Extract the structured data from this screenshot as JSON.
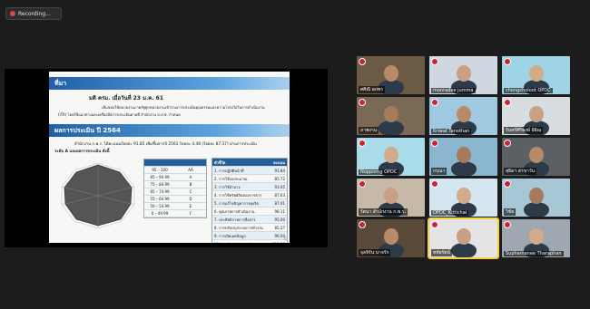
{
  "recording": {
    "label": "Recording..."
  },
  "slide": {
    "section1": "ที่มา",
    "resolution": "มติ ครม. เมื่อวันที่ 23 ม.ค. 61",
    "line1": "เห็นชอบให้หน่วยงานภาครัฐทุกหน่วยงานเข้าร่วมการประเมินคุณธรรมและความโปร่งใสในการดำเนินงาน",
    "line2": "(ITA) โดยใช้แนวทางและเครื่องมือการประเมินตามที่ สำนักงาน ป.ป.ช. กำหนด",
    "section2": "ผลการประเมิน ปี 2564",
    "result1": "สำนักงาน ก.พ.ร. ได้คะแนนร้อยละ 91.85 เพิ่มขึ้นจากปี 2563 ร้อยละ 4.48 (ร้อยละ 87.37) ผ่านการประเมิน",
    "result2": "ระดับ A และผลการประเมิน ดังนี้",
    "grades": [
      {
        "range": "95 – 100",
        "g": "AA"
      },
      {
        "range": "85 – 94.99",
        "g": "A"
      },
      {
        "range": "75 – 84.99",
        "g": "B"
      },
      {
        "range": "65 – 74.99",
        "g": "C"
      },
      {
        "range": "55 – 64.99",
        "g": "D"
      },
      {
        "range": "50 – 54.99",
        "g": "E"
      },
      {
        "range": "0 – 49.99",
        "g": "F"
      }
    ],
    "scores": [
      {
        "n": "1. การปฏิบัติหน้าที่",
        "v": "91.84"
      },
      {
        "n": "2. การใช้งบประมาณ",
        "v": "85.72"
      },
      {
        "n": "3. การใช้อำนาจ",
        "v": "93.05"
      },
      {
        "n": "4. การใช้ทรัพย์สินของราชการ",
        "v": "87.63"
      },
      {
        "n": "5. การแก้ไขปัญหาการทุจริต",
        "v": "87.01"
      },
      {
        "n": "6. คุณภาพการดำเนินงาน",
        "v": "98.11"
      },
      {
        "n": "7. ประสิทธิภาพการสื่อสาร",
        "v": "95.00"
      },
      {
        "n": "8. การปรับปรุงระบบการทำงาน",
        "v": "85.27"
      },
      {
        "n": "9. การเปิดเผยข้อมูล",
        "v": "96.00"
      },
      {
        "n": "10. การป้องกันการทุจริต",
        "v": "100.00"
      }
    ],
    "scores_header_name": "ตัวชี้วัด",
    "scores_header_value": "คะแนน",
    "page": "4"
  },
  "participants": [
    "ศศิณี ลภพร",
    "monradee jumma",
    "chongcholoot OPDC",
    "ภาพงาน",
    "Kriwat Tanothan",
    "รันทร์ศิริพงษ์ อิอิณ",
    "Nopporng OPDC",
    "กรุณา",
    "สุธิดา สาขาวัน",
    "รัตนา สำนักงาน ก.พ.ร.",
    "OPDC_Kittichai",
    "วิชัย",
    "จุลจิรัน นาจรัก",
    "หทัยรัตน์",
    "Suphamanee Tharaphan",
    "FARICHAT",
    "ปพน ลี",
    "สำนักงาน ก.พ.ร. (วีร์ชัย)"
  ]
}
